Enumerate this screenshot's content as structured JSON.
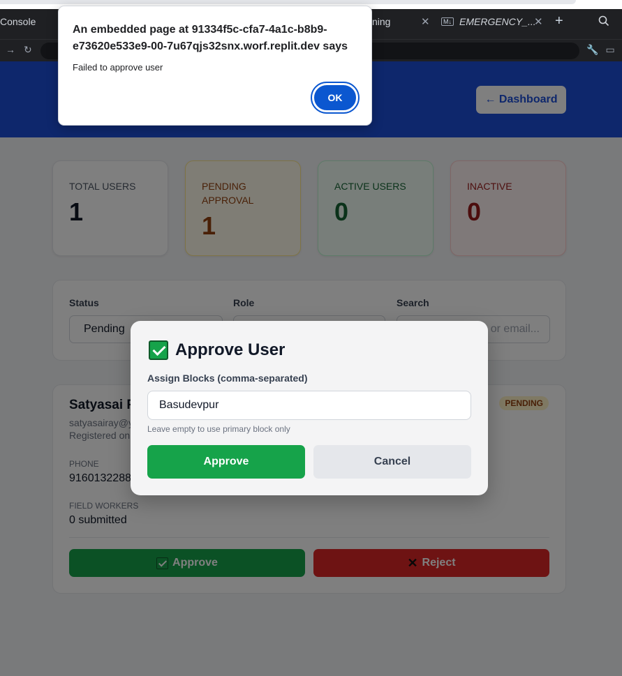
{
  "browser": {
    "tabs": [
      {
        "label": "Console"
      },
      {
        "label": "ning"
      },
      {
        "label": "EMERGENCY_...",
        "badge": "M↓"
      }
    ],
    "new_tab_symbol": "+",
    "address_url": ""
  },
  "header": {
    "title": "",
    "subtitle": "",
    "dashboard_button": "← Dashboard"
  },
  "stats": {
    "total": {
      "label": "TOTAL USERS",
      "value": "1"
    },
    "pending": {
      "label": "PENDING APPROVAL",
      "value": "1"
    },
    "active": {
      "label": "ACTIVE USERS",
      "value": "0"
    },
    "inactive": {
      "label": "INACTIVE",
      "value": "0"
    }
  },
  "filters": {
    "status_label": "Status",
    "status_value": "Pending",
    "role_label": "Role",
    "role_value": "",
    "search_label": "Search",
    "search_placeholder": "or email..."
  },
  "user_card": {
    "name": "Satyasai F",
    "email": "satyasairay@y",
    "registered": "Registered on",
    "badge": "PENDING",
    "phone_label": "PHONE",
    "phone_value": "9160132288",
    "field_workers_label": "FIELD WORKERS",
    "field_workers_value": "0 submitted",
    "approve_label": "Approve",
    "reject_label": "Reject"
  },
  "modal": {
    "title": "Approve User",
    "field_label": "Assign Blocks (comma-separated)",
    "field_value": "Basudevpur",
    "hint": "Leave empty to use primary block only",
    "approve_button": "Approve",
    "cancel_button": "Cancel"
  },
  "alert": {
    "message": "An embedded page at 91334f5c-cfa7-4a1c-b8b9-e73620e533e9-00-7u67qjs32snx.worf.replit.dev says",
    "body": "Failed to approve user",
    "ok_button": "OK"
  },
  "colors": {
    "header_blue": "#1d4ed8",
    "approve_green": "#16a34a",
    "reject_red": "#dc2626",
    "pending_amber": "#92400e",
    "dialog_button_blue": "#0b57d0"
  }
}
